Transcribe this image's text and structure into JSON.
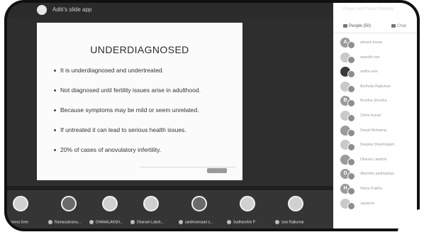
{
  "window": {
    "title": "Aditi's slide app"
  },
  "slide": {
    "title": "UNDERDIAGNOSED",
    "bullets": [
      "It is underdiagnosed and undertreated.",
      "Not diagnosed until fertility issues arise in adulthood.",
      "Because symptoms may be mild or seem unrelated.",
      "If untreated it can lead to serious health issues.",
      "20% of cases of anovulatory infertility."
    ],
    "share_text": "Stop sharing"
  },
  "participants_strip": [
    {
      "name": "Abarnna Sree"
    },
    {
      "name": "Ramasubrama..."
    },
    {
      "name": "DHANALAKSH..."
    },
    {
      "name": "Dhanam Laksh..."
    },
    {
      "name": "santhosesaari s..."
    },
    {
      "name": "Sudharshini P"
    },
    {
      "name": "Iyas Rajkumar"
    }
  ],
  "panel": {
    "title": "Prayer and Praise Meeting",
    "tab_people": "People (50)",
    "tab_chat": "Chat",
    "people": [
      {
        "initial": "A",
        "name": "abirami kanan"
      },
      {
        "initial": "",
        "name": "anandhi ravi"
      },
      {
        "initial": "",
        "name": "anitha sree"
      },
      {
        "initial": "",
        "name": "Berthalia Rajkumar"
      },
      {
        "initial": "B",
        "name": "Bruntha Srinutha"
      },
      {
        "initial": "",
        "name": "Chitra Kumar"
      },
      {
        "initial": "",
        "name": "Deepti Mohanraj"
      },
      {
        "initial": "",
        "name": "Deepika Shanmugam"
      },
      {
        "initial": "",
        "name": "Dharani Lakshmi"
      },
      {
        "initial": "D",
        "name": "dharshini padmapriya"
      },
      {
        "initial": "H",
        "name": "Hema Prabha"
      },
      {
        "initial": "",
        "name": "Jayasree"
      }
    ]
  }
}
